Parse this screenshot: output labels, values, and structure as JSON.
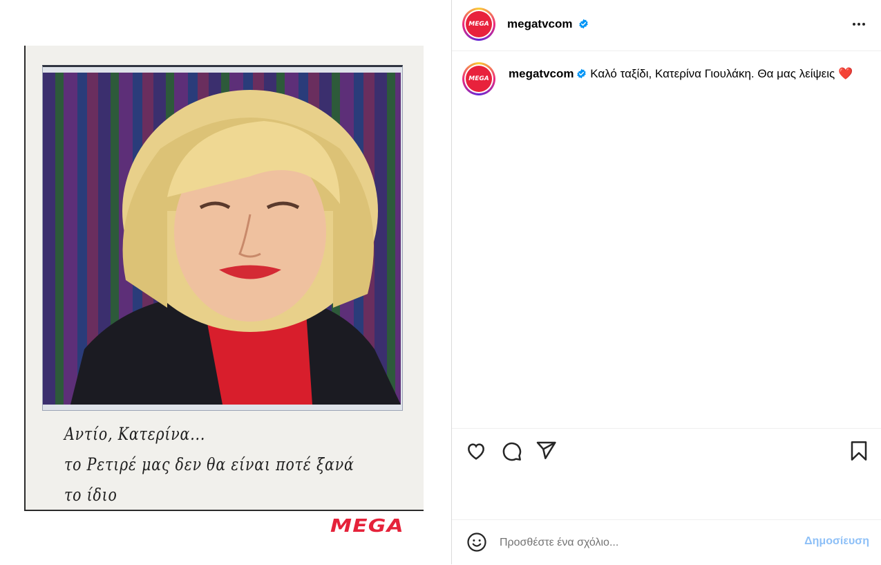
{
  "post": {
    "image_handwriting": {
      "line1": "Αντίο, Κατερίνα...",
      "line2": "το Ρετιρέ μας δεν θα είναι ποτέ ξανά το ίδιο"
    },
    "image_logo_text": "MEGA"
  },
  "header": {
    "avatar_text": "MEGA",
    "username": "megatvcom",
    "more_icon": "more-horizontal-icon"
  },
  "caption": {
    "username": "megatvcom",
    "text": "Καλό ταξίδι, Κατερίνα Γιουλάκη. Θα μας λείψεις",
    "emoji": "❤️"
  },
  "actions": {
    "icons": [
      "heart-icon",
      "comment-icon",
      "share-icon",
      "bookmark-icon"
    ]
  },
  "comment": {
    "placeholder": "Προσθέστε ένα σχόλιο...",
    "post_label": "Δημοσίευση",
    "emoji_icon": "emoji-icon"
  },
  "colors": {
    "brand_red": "#e5223a",
    "verified_blue": "#0095f6",
    "post_button_disabled": "#8ec0f7"
  }
}
